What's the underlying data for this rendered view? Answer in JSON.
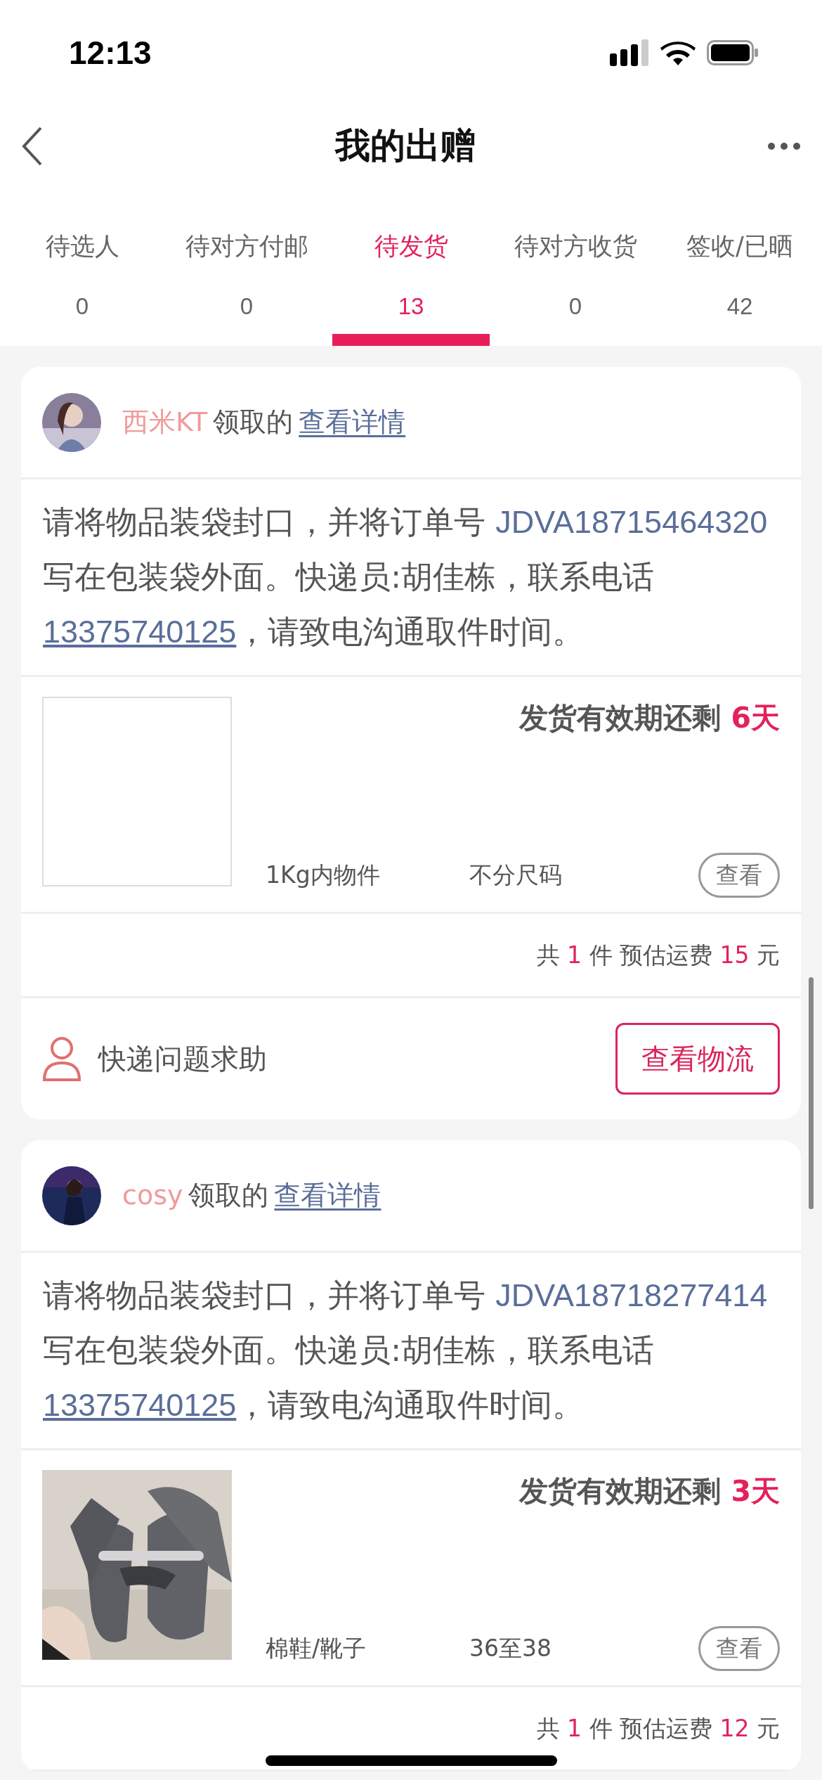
{
  "status_bar": {
    "time": "12:13"
  },
  "nav": {
    "title": "我的出赠"
  },
  "tabs": [
    {
      "label": "待选人",
      "count": "0",
      "selected": false
    },
    {
      "label": "待对方付邮",
      "count": "0",
      "selected": false
    },
    {
      "label": "待发货",
      "count": "13",
      "selected": true
    },
    {
      "label": "待对方收货",
      "count": "0",
      "selected": false
    },
    {
      "label": "签收/已晒",
      "count": "42",
      "selected": false
    }
  ],
  "orders": [
    {
      "user": "西米KT",
      "claimed": "领取的",
      "details_link": "查看详情",
      "instruction": {
        "before": "请将物品装袋封口，并将订单号 ",
        "order_no": "JDVA18715464320",
        "middle": " 写在包装袋外面。快递员:胡佳栋，联系电话",
        "phone": "13375740125",
        "after": "，请致电沟通取件时间。"
      },
      "deadline_label": "发货有效期还剩",
      "deadline": "6天",
      "product_image": {
        "kind": "blank"
      },
      "category": "1Kg内物件",
      "size": "不分尺码",
      "view_button": "查看",
      "total": {
        "prefix": "共",
        "count": "1",
        "unit": "件 预估运费",
        "fee": "15",
        "currency": "元"
      },
      "help": "快递问题求助",
      "logistics_button": "查看物流"
    },
    {
      "user": "cosy",
      "claimed": "领取的",
      "details_link": "查看详情",
      "instruction": {
        "before": "请将物品装袋封口，并将订单号 ",
        "order_no": "JDVA18718277414",
        "middle": " 写在包装袋外面。快递员:胡佳栋，联系电话",
        "phone": "13375740125",
        "after": "，请致电沟通取件时间。"
      },
      "deadline_label": "发货有效期还剩",
      "deadline": "3天",
      "category": "棉鞋/靴子",
      "size": "36至38",
      "view_button": "查看",
      "total": {
        "prefix": "共",
        "count": "1",
        "unit": "件 预估运费",
        "fee": "12",
        "currency": "元"
      }
    }
  ]
}
